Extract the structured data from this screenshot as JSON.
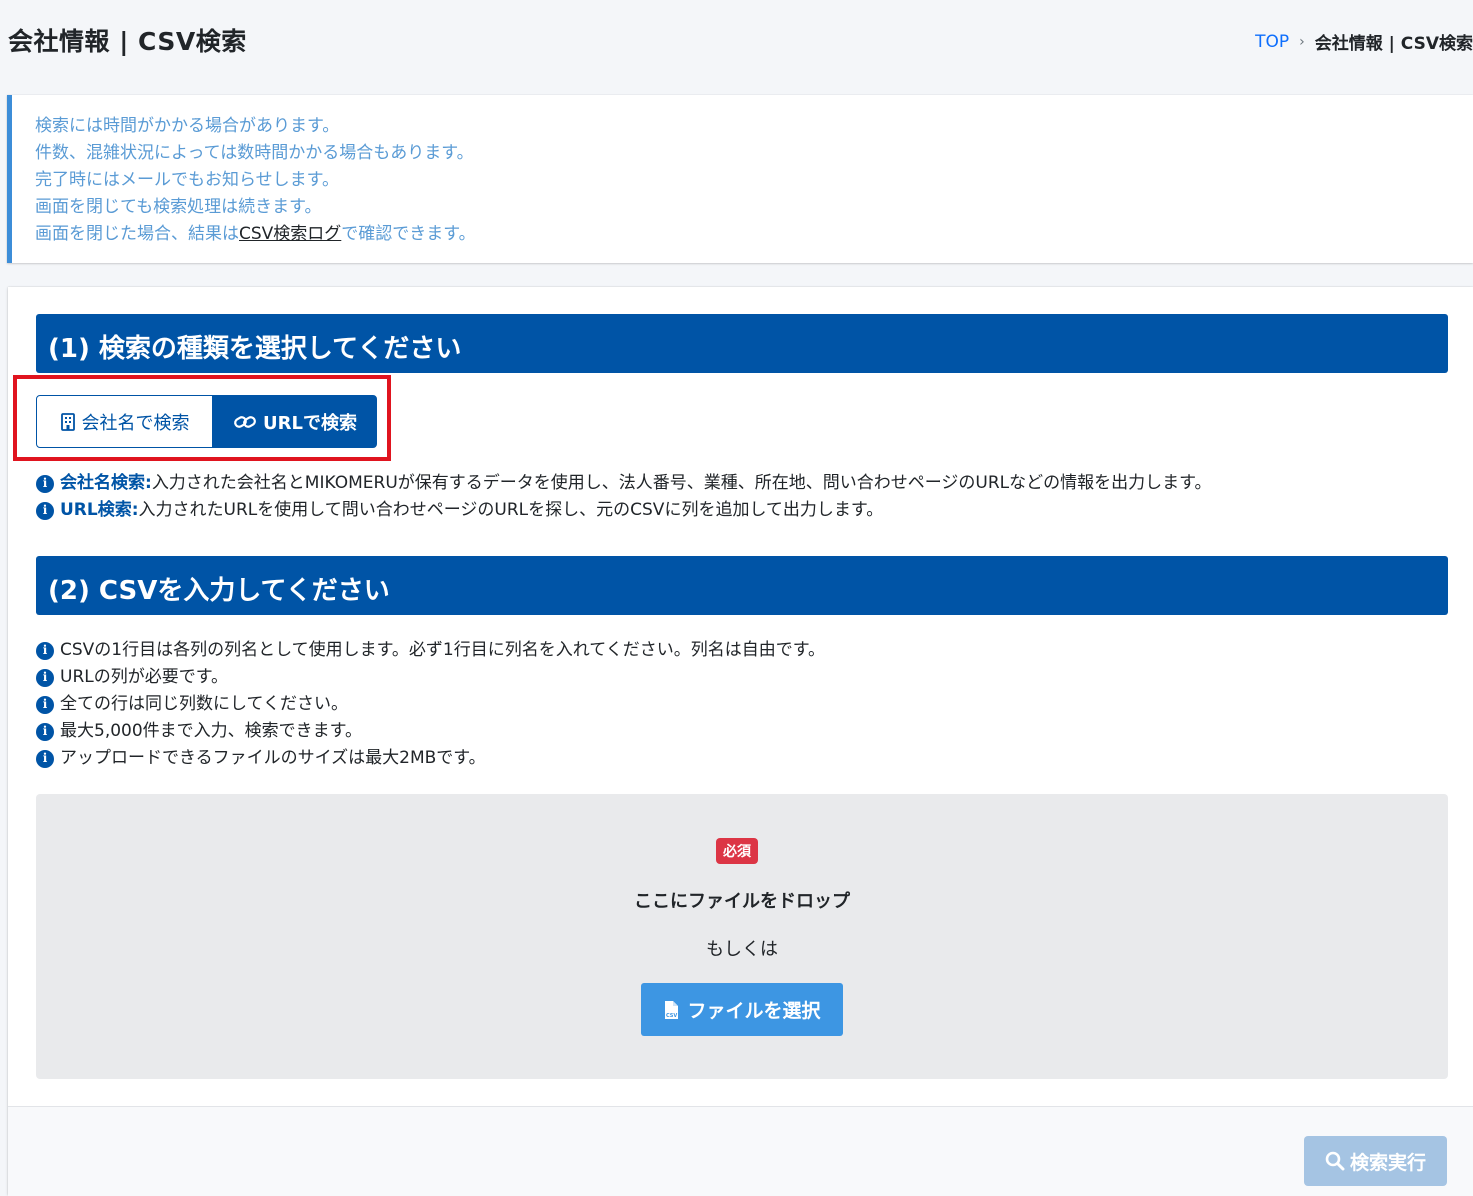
{
  "header": {
    "title": "会社情報 | CSV検索",
    "breadcrumb": {
      "home": "TOP",
      "separator": "›",
      "current": "会社情報 | CSV検索"
    }
  },
  "notice": {
    "lines": [
      "検索には時間がかかる場合があります。",
      "件数、混雑状況によっては数時間かかる場合もあります。",
      "完了時にはメールでもお知らせします。",
      "画面を閉じても検索処理は続きます。"
    ],
    "last_line_prefix": "画面を閉じた場合、結果は",
    "last_line_link": "CSV検索ログ",
    "last_line_suffix": "で確認できます。"
  },
  "step1": {
    "heading": "(1) 検索の種類を選択してください",
    "buttons": {
      "company": {
        "label": "会社名で検索",
        "icon": "building-icon"
      },
      "url": {
        "label": "URLで検索",
        "icon": "link-icon",
        "selected": true
      }
    },
    "info": [
      {
        "term": "会社名検索",
        "sep": " : ",
        "text": "入力された会社名とMIKOMERUが保有するデータを使用し、法人番号、業種、所在地、問い合わせページのURLなどの情報を出力します。"
      },
      {
        "term": "URL検索",
        "sep": " : ",
        "text": "入力されたURLを使用して問い合わせページのURLを探し、元のCSVに列を追加して出力します。"
      }
    ]
  },
  "step2": {
    "heading": "(2) CSVを入力してください",
    "info": [
      "CSVの1行目は各列の列名として使用します。必ず1行目に列名を入れてください。列名は自由です。",
      "URLの列が必要です。",
      "全ての行は同じ列数にしてください。",
      "最大5,000件まで入力、検索できます。",
      "アップロードできるファイルのサイズは最大2MBです。"
    ],
    "dropzone": {
      "badge": "必須",
      "title": "ここにファイルをドロップ",
      "or": "もしくは",
      "button": "ファイルを選択"
    }
  },
  "footer": {
    "submit": "検索実行",
    "submit_enabled": false
  },
  "colors": {
    "primary": "#0054a6",
    "callout_text": "#5a9bd5",
    "badge": "#dc3545",
    "highlight": "#e0141f"
  }
}
